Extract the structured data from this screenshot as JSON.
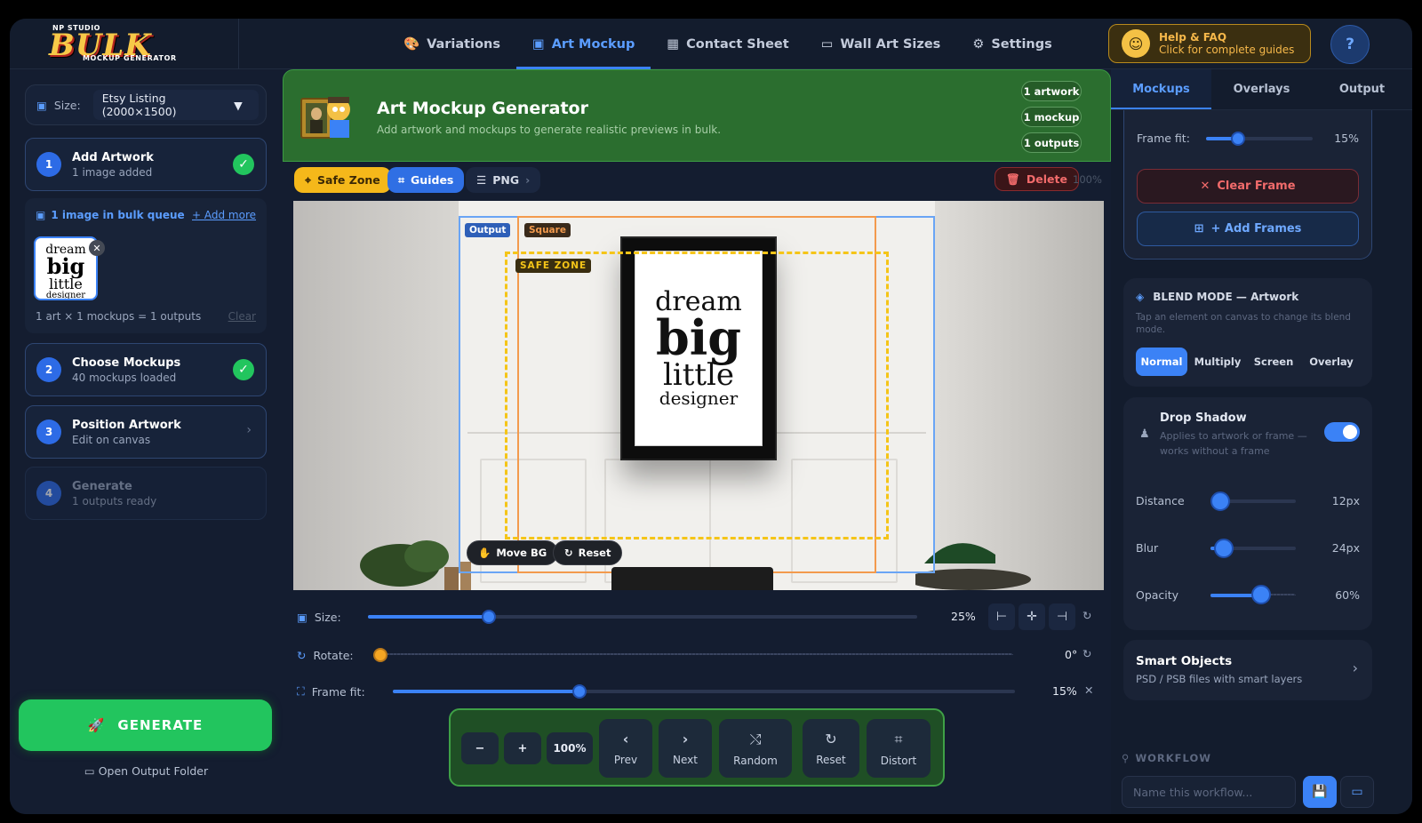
{
  "logo": {
    "top": "NP STUDIO",
    "main": "BULK",
    "sub": "MOCKUP GENERATOR"
  },
  "nav": [
    {
      "label": "Variations",
      "icon": "palette-icon"
    },
    {
      "label": "Art Mockup",
      "icon": "image-icon",
      "active": true
    },
    {
      "label": "Contact Sheet",
      "icon": "grid-icon"
    },
    {
      "label": "Wall Art Sizes",
      "icon": "ruler-icon"
    },
    {
      "label": "Settings",
      "icon": "gear-icon"
    }
  ],
  "help": {
    "title": "Help & FAQ",
    "subtitle": "Click for complete guides"
  },
  "left": {
    "size_label": "Size:",
    "size_value": "Etsy Listing (2000×1500)",
    "steps": [
      {
        "num": "1",
        "title": "Add Artwork",
        "sub": "1 image added"
      },
      {
        "num": "2",
        "title": "Choose Mockups",
        "sub": "40 mockups loaded"
      },
      {
        "num": "3",
        "title": "Position Artwork",
        "sub": "Edit on canvas"
      },
      {
        "num": "4",
        "title": "Generate",
        "sub": "1 outputs ready"
      }
    ],
    "queue_title": "1 image in bulk queue",
    "queue_add": "+ Add more",
    "queue_summary": "1 art × 1 mockups = 1 outputs",
    "queue_clear": "Clear",
    "thumb_lines": [
      "dream",
      "big",
      "little",
      "designer"
    ],
    "generate": "GENERATE",
    "open_folder": "Open Output Folder"
  },
  "hero": {
    "title": "Art Mockup Generator",
    "subtitle": "Add artwork and mockups to generate realistic previews in bulk.",
    "pills": [
      "1 artwork",
      "1 mockup",
      "1 outputs"
    ]
  },
  "toolbar": {
    "safe_zone": "Safe Zone",
    "guides": "Guides",
    "format": "PNG",
    "delete": "Delete",
    "zoom_readout": "100%"
  },
  "canvas": {
    "tag_output": "Output",
    "tag_square": "Square",
    "tag_safe": "SAFE ZONE",
    "art_lines": [
      "dream",
      "big",
      "little",
      "designer"
    ],
    "move_bg": "Move BG",
    "reset": "Reset"
  },
  "controls": {
    "size_label": "Size:",
    "size_value": "25%",
    "size_fraction": 0.22,
    "rotate_label": "Rotate:",
    "rotate_value": "0°",
    "rotate_fraction": 0.0,
    "frame_fit_label": "Frame fit:",
    "frame_fit_value": "15%",
    "frame_fit_fraction": 0.3
  },
  "bottom": {
    "zoom": "100%",
    "minus": "−",
    "plus": "+",
    "prev": "Prev",
    "next": "Next",
    "random": "Random",
    "reset": "Reset",
    "distort": "Distort"
  },
  "right": {
    "tabs": [
      "Mockups",
      "Overlays",
      "Output"
    ],
    "frame_fit_label": "Frame fit:",
    "frame_fit_value": "15%",
    "frame_fit_fraction": 0.3,
    "clear_frame": "Clear Frame",
    "add_frames": "+ Add Frames",
    "blend_title": "BLEND MODE — Artwork",
    "blend_hint": "Tap an element on canvas to change its blend mode.",
    "blend_modes": [
      "Normal",
      "Multiply",
      "Screen",
      "Overlay"
    ],
    "shadow_title": "Drop Shadow",
    "shadow_sub": "Applies to artwork or frame — works without a frame",
    "distance_label": "Distance",
    "distance_value": "12px",
    "blur_label": "Blur",
    "blur_value": "24px",
    "opacity_label": "Opacity",
    "opacity_value": "60%",
    "smart_title": "Smart Objects",
    "smart_sub": "PSD / PSB files with smart layers",
    "workflow_title": "WORKFLOW",
    "workflow_placeholder": "Name this workflow..."
  },
  "colors": {
    "accent": "#3b82f6",
    "green": "#22c55e",
    "hero": "#2b6e2f",
    "safe": "#f5c518",
    "square": "#f39a4d"
  }
}
